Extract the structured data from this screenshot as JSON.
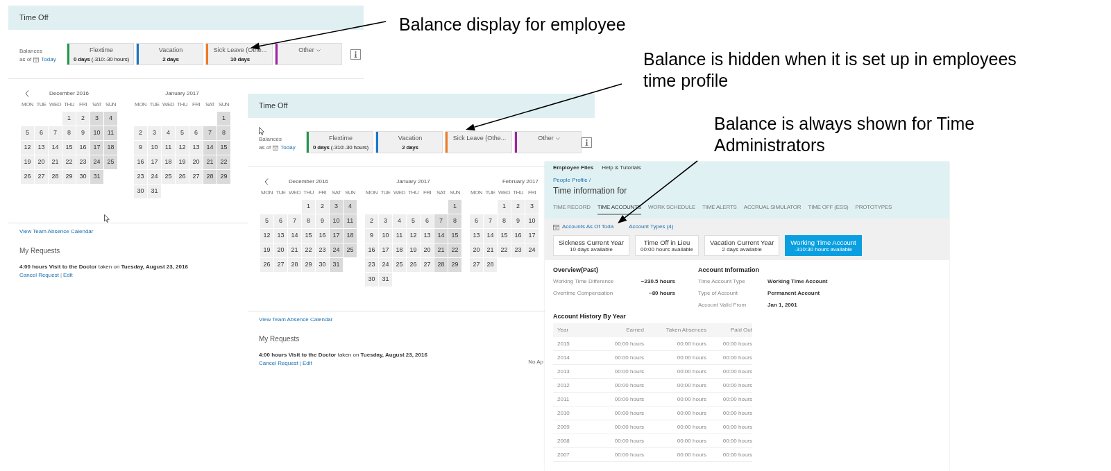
{
  "annotations": [
    {
      "text": "Balance display for employee"
    },
    {
      "text": "Balance is hidden when it is set up in employees\ntime profile"
    },
    {
      "text": "Balance is always shown for Time\nAdministrators"
    }
  ],
  "employee_view": {
    "title": "Time Off",
    "balances_label": "Balances",
    "as_of": "as of",
    "today": "Today",
    "balances": [
      {
        "kind": "balance",
        "name": "Flextime",
        "value": "**0 days** (-310:-30 hours)",
        "color": "#1e9a4a"
      },
      {
        "kind": "balance",
        "name": "Vacation",
        "value": "**2 days**",
        "color": "#1877c9"
      },
      {
        "kind": "balance",
        "name": "Sick Leave (Othe...",
        "value": "**10 days**",
        "color": "#f07a22"
      },
      {
        "kind": "dropdown",
        "name": "Other",
        "color": "#a31fa6"
      }
    ],
    "calendars": [
      {
        "title": "December 2016",
        "weekdays": [
          "MON",
          "TUE",
          "WED",
          "THU",
          "FRI",
          "SAT",
          "SUN"
        ],
        "weeks": [
          {
            "kind": "leading",
            "days": [
              "1",
              "2",
              "3",
              "4"
            ]
          },
          {
            "kind": "full",
            "days": [
              "5",
              "6",
              "7",
              "8",
              "9",
              "10",
              "11"
            ]
          },
          {
            "kind": "full",
            "days": [
              "12",
              "13",
              "14",
              "15",
              "16",
              "17",
              "18"
            ]
          },
          {
            "kind": "full",
            "days": [
              "19",
              "20",
              "21",
              "22",
              "23",
              "24",
              "25"
            ]
          },
          {
            "kind": "trailing",
            "days": [
              "26",
              "27",
              "28",
              "29",
              "30",
              "31"
            ]
          }
        ]
      },
      {
        "title": "January 2017",
        "weekdays": [
          "MON",
          "TUE",
          "WED",
          "THU",
          "FRI",
          "SAT",
          "SUN"
        ],
        "weeks": [
          {
            "kind": "leading",
            "days": [
              "1"
            ]
          },
          {
            "kind": "full",
            "days": [
              "2",
              "3",
              "4",
              "5",
              "6",
              "7",
              "8"
            ]
          },
          {
            "kind": "full",
            "days": [
              "9",
              "10",
              "11",
              "12",
              "13",
              "14",
              "15"
            ]
          },
          {
            "kind": "full",
            "days": [
              "16",
              "17",
              "18",
              "19",
              "20",
              "21",
              "22"
            ]
          },
          {
            "kind": "full",
            "days": [
              "23",
              "24",
              "25",
              "26",
              "27",
              "28",
              "29"
            ]
          },
          {
            "kind": "trailing",
            "days": [
              "30",
              "31"
            ]
          }
        ]
      }
    ],
    "team_link": "View Team Absence Calendar",
    "requests_title": "My Requests",
    "request": {
      "text": "**4:00 hours Visit to the Doctor** taken on **Tuesday, August 23, 2016**",
      "cancel": "Cancel Request",
      "separator": "|",
      "edit": "Edit"
    }
  },
  "employee_view_hidden_balance": {
    "title": "Time Off",
    "balances_label": "Balances",
    "as_of": "as of",
    "today": "Today",
    "balances": [
      {
        "kind": "balance",
        "name": "Flextime",
        "value": "**0 days** (-310:-30 hours)",
        "color": "#1e9a4a"
      },
      {
        "kind": "balance",
        "name": "Vacation",
        "value": "**2 days**",
        "color": "#1877c9"
      },
      {
        "kind": "balance",
        "name": "Sick Leave (Othe...",
        "color": "#f07a22"
      },
      {
        "kind": "dropdown",
        "name": "Other",
        "color": "#a31fa6"
      }
    ],
    "calendars": [
      {
        "title": "December 2016",
        "weekdays": [
          "MON",
          "TUE",
          "WED",
          "THU",
          "FRI",
          "SAT",
          "SUN"
        ],
        "weeks": [
          {
            "kind": "leading",
            "days": [
              "1",
              "2",
              "3",
              "4"
            ]
          },
          {
            "kind": "full",
            "days": [
              "5",
              "6",
              "7",
              "8",
              "9",
              "10",
              "11"
            ]
          },
          {
            "kind": "full",
            "days": [
              "12",
              "13",
              "14",
              "15",
              "16",
              "17",
              "18"
            ]
          },
          {
            "kind": "full",
            "days": [
              "19",
              "20",
              "21",
              "22",
              "23",
              "24",
              "25"
            ]
          },
          {
            "kind": "trailing",
            "days": [
              "26",
              "27",
              "28",
              "29",
              "30",
              "31"
            ]
          }
        ]
      },
      {
        "title": "January 2017",
        "weekdays": [
          "MON",
          "TUE",
          "WED",
          "THU",
          "FRI",
          "SAT",
          "SUN"
        ],
        "weeks": [
          {
            "kind": "leading",
            "days": [
              "1"
            ]
          },
          {
            "kind": "full",
            "days": [
              "2",
              "3",
              "4",
              "5",
              "6",
              "7",
              "8"
            ]
          },
          {
            "kind": "full",
            "days": [
              "9",
              "10",
              "11",
              "12",
              "13",
              "14",
              "15"
            ]
          },
          {
            "kind": "full",
            "days": [
              "16",
              "17",
              "18",
              "19",
              "20",
              "21",
              "22"
            ]
          },
          {
            "kind": "full",
            "days": [
              "23",
              "24",
              "25",
              "26",
              "27",
              "28",
              "29"
            ]
          },
          {
            "kind": "trailing",
            "days": [
              "30",
              "31"
            ]
          }
        ]
      },
      {
        "title": "February 2017",
        "weekdays": [
          "MON",
          "TUE",
          "WED",
          "THU",
          "FRI"
        ],
        "weeks": [
          {
            "kind": "leading",
            "days": [
              "1",
              "2",
              "3"
            ]
          },
          {
            "kind": "full",
            "days": [
              "6",
              "7",
              "8",
              "9",
              "10"
            ]
          },
          {
            "kind": "full",
            "days": [
              "13",
              "14",
              "15",
              "16",
              "17"
            ]
          },
          {
            "kind": "full",
            "days": [
              "20",
              "21",
              "22",
              "23",
              "24"
            ]
          },
          {
            "kind": "trailing",
            "days": [
              "27",
              "28"
            ]
          }
        ]
      }
    ],
    "team_link": "View Team Absence Calendar",
    "requests_title": "My Requests",
    "request": {
      "text": "**4:00 hours Visit to the Doctor** taken on **Tuesday, August 23, 2016**",
      "cancel": "Cancel Request",
      "separator": "|",
      "edit": "Edit",
      "status": "No Ap"
    }
  },
  "admin_view": {
    "top_nav": [
      {
        "label": "Employee Files",
        "selected": true
      },
      {
        "label": "Help & Tutorials",
        "selected": false
      }
    ],
    "breadcrumb": "People Profile /",
    "title": "Time information for",
    "tabs": [
      {
        "label": "TIME RECORD",
        "selected": false
      },
      {
        "label": "TIME ACCOUNTS",
        "selected": true
      },
      {
        "label": "WORK SCHEDULE",
        "selected": false
      },
      {
        "label": "TIME ALERTS",
        "selected": false
      },
      {
        "label": "ACCRUAL SIMULATOR",
        "selected": false
      },
      {
        "label": "TIME OFF (ESS)",
        "selected": false
      },
      {
        "label": "PROTOTYPES",
        "selected": false
      }
    ],
    "accounts_as_of": "Accounts As Of Toda",
    "account_types": "Account Types (4)",
    "accounts": [
      {
        "name": "Sickness Current Year",
        "detail": "10 days available",
        "selected": false
      },
      {
        "name": "Time Off in Lieu",
        "detail": "00:00 hours available",
        "selected": false
      },
      {
        "name": "Vacation Current Year",
        "detail": "2 days available",
        "selected": false
      },
      {
        "name": "Working Time Account",
        "detail": "-310:30 hours available",
        "selected": true
      }
    ],
    "overview": {
      "title": "Overview(Past)",
      "rows": [
        {
          "label": "Working Time Difference",
          "value": "−230.5 hours"
        },
        {
          "label": "Overtime Compensation",
          "value": "−80 hours"
        }
      ]
    },
    "account_info": {
      "title": "Account Information",
      "rows": [
        {
          "label": "Time Account Type",
          "value": "Working Time Account"
        },
        {
          "label": "Type of Account",
          "value": "Permanent Account"
        },
        {
          "label": "Account Valid From",
          "value": "Jan 1, 2001"
        }
      ]
    },
    "history": {
      "title": "Account History By Year",
      "columns": [
        "Year",
        "Earned",
        "Taken Absences",
        "Paid Out"
      ],
      "rows": [
        [
          "2015",
          "00:00 hours",
          "00:00 hours",
          "00:00 hours"
        ],
        [
          "2014",
          "00:00 hours",
          "00:00 hours",
          "00:00 hours"
        ],
        [
          "2013",
          "00:00 hours",
          "00:00 hours",
          "00:00 hours"
        ],
        [
          "2012",
          "00:00 hours",
          "00:00 hours",
          "00:00 hours"
        ],
        [
          "2011",
          "00:00 hours",
          "00:00 hours",
          "00:00 hours"
        ],
        [
          "2010",
          "00:00 hours",
          "00:00 hours",
          "00:00 hours"
        ],
        [
          "2009",
          "00:00 hours",
          "00:00 hours",
          "00:00 hours"
        ],
        [
          "2008",
          "00:00 hours",
          "00:00 hours",
          "00:00 hours"
        ],
        [
          "2007",
          "00:00 hours",
          "00:00 hours",
          "00:00 hours"
        ]
      ]
    }
  }
}
